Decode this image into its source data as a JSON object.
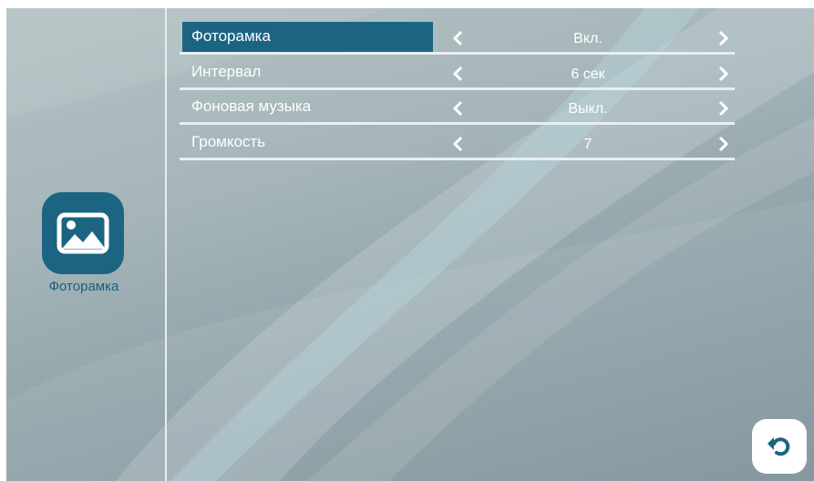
{
  "sidebar": {
    "icon": "image-icon",
    "label": "Фоторамка",
    "accent_color": "#1c6582"
  },
  "settings": [
    {
      "label": "Фоторамка",
      "value": "Вкл.",
      "selected": true
    },
    {
      "label": "Интервал",
      "value": "6 сек",
      "selected": false
    },
    {
      "label": "Фоновая музыка",
      "value": "Выкл.",
      "selected": false
    },
    {
      "label": "Громкость",
      "value": "7",
      "selected": false
    }
  ],
  "icons": {
    "prev": "chevron-left-icon",
    "next": "chevron-right-icon",
    "back": "back-arrow-icon"
  }
}
